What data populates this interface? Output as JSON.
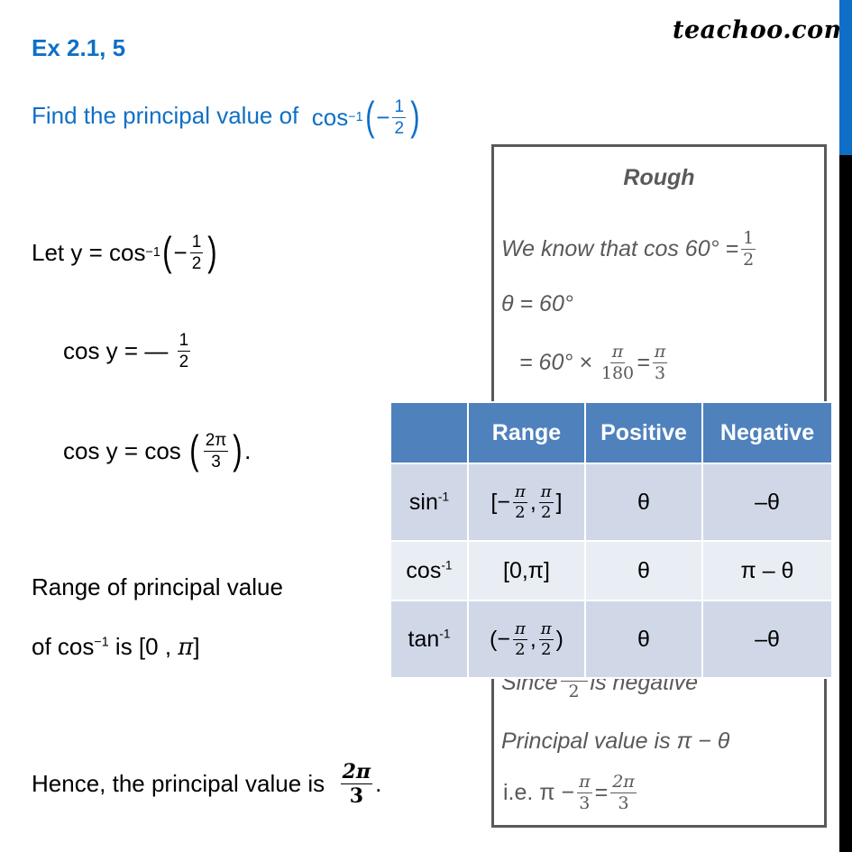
{
  "header": {
    "exercise_label": "Ex 2.1, 5",
    "question_prefix": "Find the principal value of",
    "question_func": "cos",
    "question_exp": "−1",
    "question_sign": "−",
    "question_num": "1",
    "question_den": "2",
    "logo": "teachoo.com"
  },
  "colors": {
    "accent": "#0f6fc6",
    "table_header": "#4f81bd",
    "table_row_odd": "#d0d8e8",
    "table_row_even": "#e9edf4",
    "rough_text": "#595959"
  },
  "solution": {
    "line1_prefix": "Let y = cos",
    "line1_exp": "−1",
    "line1_sign": "−",
    "line1_num": "1",
    "line1_den": "2",
    "line2_prefix": "cos y = —",
    "line2_num": "1",
    "line2_den": "2",
    "line3_prefix": "cos y = cos",
    "line3_num": "2π",
    "line3_den": "3",
    "line3_suffix": ".",
    "range_line1": "Range of principal value",
    "range_line2_prefix": "of cos",
    "range_line2_exp": "−1",
    "range_line2_suffix": " is [0 , ",
    "range_line2_pi": "π",
    "range_line2_close": "]",
    "conclusion_prefix": "Hence, the principal value is",
    "conclusion_num": "2π",
    "conclusion_den": "3",
    "conclusion_suffix": "."
  },
  "rough": {
    "title": "Rough",
    "line1_prefix": "We know that cos 60° =",
    "line1_num": "1",
    "line1_den": "2",
    "line2": "θ = 60°",
    "line3_prefix": "= 60° ×",
    "line3_num1": "π",
    "line3_den1": "180",
    "line3_eq": "=",
    "line3_num2": "π",
    "line3_den2": "3",
    "line4_prefix": "Since",
    "line4_num": "",
    "line4_den": "2",
    "line4_suffix": "is negative",
    "line5": "Principal value is π − θ",
    "line6_prefix": "i.e. π −",
    "line6_num1": "π",
    "line6_den1": "3",
    "line6_eq": "=",
    "line6_num2": "2π",
    "line6_den2": "3"
  },
  "table": {
    "headers": [
      "",
      "Range",
      "Positive",
      "Negative"
    ],
    "rows": [
      {
        "func": "sin",
        "exp": "-1",
        "range_open": "[−",
        "range_close": "]",
        "positive": "θ",
        "negative": "–θ"
      },
      {
        "func": "cos",
        "exp": "-1",
        "range": "[0,π]",
        "positive": "θ",
        "negative": "π – θ"
      },
      {
        "func": "tan",
        "exp": "-1",
        "range_open": "(−",
        "range_close": ")",
        "positive": "θ",
        "negative": "–θ"
      }
    ],
    "frac_num": "π",
    "frac_den": "2",
    "frac_sep": ","
  }
}
